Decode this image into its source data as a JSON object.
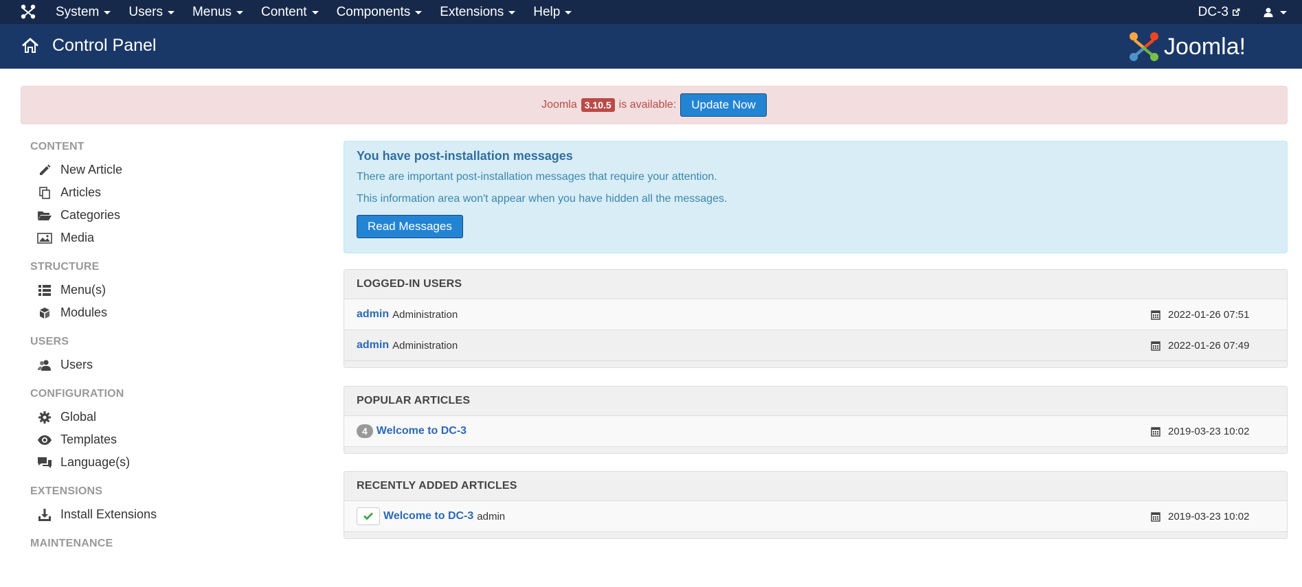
{
  "topbar": {
    "menu": [
      "System",
      "Users",
      "Menus",
      "Content",
      "Components",
      "Extensions",
      "Help"
    ],
    "site_name": "DC-3"
  },
  "header": {
    "title": "Control Panel",
    "brand": "Joomla!"
  },
  "update": {
    "prefix": "Joomla",
    "version": "3.10.5",
    "suffix": "is available:",
    "button": "Update Now"
  },
  "sidebar": {
    "content_heading": "CONTENT",
    "content_items": [
      {
        "label": "New Article",
        "icon": "pencil-icon"
      },
      {
        "label": "Articles",
        "icon": "copy-icon"
      },
      {
        "label": "Categories",
        "icon": "folder-icon"
      },
      {
        "label": "Media",
        "icon": "image-icon"
      }
    ],
    "structure_heading": "STRUCTURE",
    "structure_items": [
      {
        "label": "Menu(s)",
        "icon": "list-icon"
      },
      {
        "label": "Modules",
        "icon": "cube-icon"
      }
    ],
    "users_heading": "USERS",
    "users_items": [
      {
        "label": "Users",
        "icon": "users-icon"
      }
    ],
    "configuration_heading": "CONFIGURATION",
    "configuration_items": [
      {
        "label": "Global",
        "icon": "gear-icon"
      },
      {
        "label": "Templates",
        "icon": "eye-icon"
      },
      {
        "label": "Language(s)",
        "icon": "comments-icon"
      }
    ],
    "extensions_heading": "EXTENSIONS",
    "extensions_items": [
      {
        "label": "Install Extensions",
        "icon": "download-icon"
      }
    ],
    "maintenance_heading": "MAINTENANCE"
  },
  "messages": {
    "title": "You have post-installation messages",
    "line1": "There are important post-installation messages that require your attention.",
    "line2": "This information area won't appear when you have hidden all the messages.",
    "button": "Read Messages"
  },
  "logged_in": {
    "title": "LOGGED-IN USERS",
    "rows": [
      {
        "name": "admin",
        "area": "Administration",
        "date": "2022-01-26 07:51"
      },
      {
        "name": "admin",
        "area": "Administration",
        "date": "2022-01-26 07:49"
      }
    ]
  },
  "popular": {
    "title": "POPULAR ARTICLES",
    "rows": [
      {
        "hits": "4",
        "name": "Welcome to DC-3",
        "date": "2019-03-23 10:02"
      }
    ]
  },
  "recent": {
    "title": "RECENTLY ADDED ARTICLES",
    "rows": [
      {
        "name": "Welcome to DC-3",
        "author": "admin",
        "date": "2019-03-23 10:02"
      }
    ]
  },
  "colors": {
    "topbar": "#17294a",
    "header": "#1a3867",
    "button": "#2384d3",
    "link": "#2a69b8"
  }
}
